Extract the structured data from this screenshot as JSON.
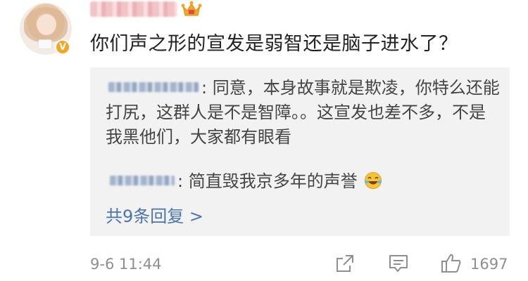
{
  "post": {
    "comment_text": "你们声之形的宣发是弱智还是脑子进水了？",
    "timestamp": "9-6 11:44",
    "like_count": "1697"
  },
  "replies": {
    "items": [
      {
        "separator": ":",
        "text": "同意，本身故事就是欺凌，你特么还能打尻，这群人是不是智障。。这宣发也差不多，不是我黑他们，大家都有眼看"
      },
      {
        "separator": ":",
        "text": "简直毁我京多年的声誉"
      }
    ],
    "more_label": "共9条回复 >"
  },
  "icons": {
    "badge": "verified-v-icon",
    "member": "crown-icon",
    "emoji": "laughing-tears-emoji",
    "actions": [
      "share-icon",
      "comment-icon",
      "like-icon"
    ]
  },
  "colors": {
    "link": "#4a74ae",
    "meta": "#8f8f8f",
    "reply_bg": "#f2f2f2",
    "badge": "#f5a623"
  }
}
